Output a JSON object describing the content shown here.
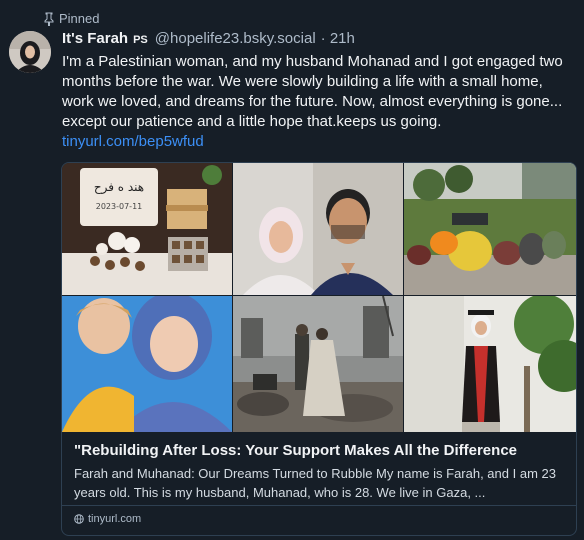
{
  "pinned_label": "Pinned",
  "author": {
    "display_name": "It's Farah",
    "verified_tag": "PS",
    "handle": "@hopelife23.bsky.social",
    "time_ago": "· 21h"
  },
  "post": {
    "text": "I'm a Palestinian woman, and my husband Mohanad and I got engaged two months before the war. We were slowly building a life with a small home, work we loved, and dreams for the future. Now, almost everything is gone... except our patience and a little hope that.keeps us going.",
    "link_text": "tinyurl.com/bep5wfud"
  },
  "embed": {
    "title": "\"Rebuilding After Loss: Your Support Makes All the Difference",
    "description": "Farah and Muhanad: Our Dreams Turned to Rubble My name is Farah, and I am 23 years old. This is my husband, Muhanad, who is 28. We live in Gaza, ...",
    "domain": "tinyurl.com",
    "cake_text": "هند ه فرح",
    "cake_date": "2023-07-11"
  },
  "colors": {
    "background": "#161e27",
    "link": "#3c8ff5",
    "border": "#2e4052",
    "muted_text": "#aebbc9"
  }
}
